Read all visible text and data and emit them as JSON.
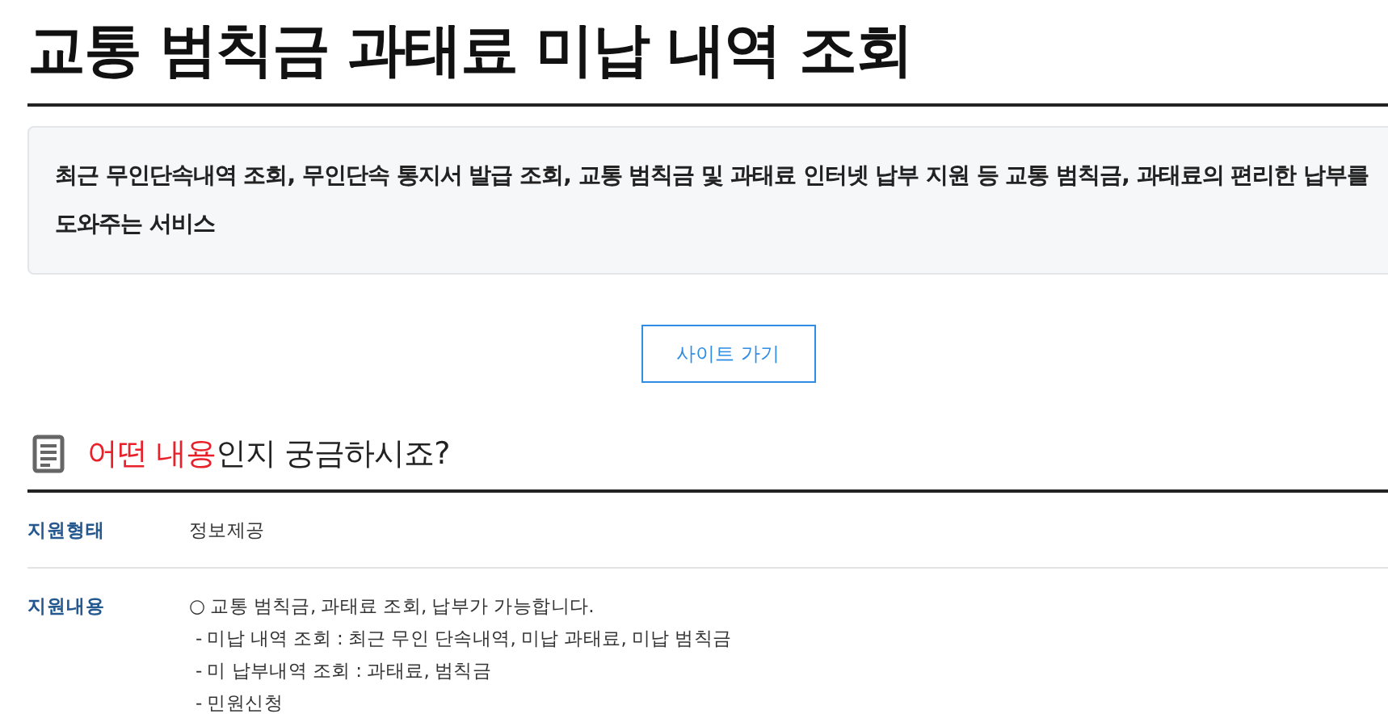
{
  "title": "교통 범칙금 과태료 미납 내역 조회",
  "description": "최근 무인단속내역 조회, 무인단속 통지서 발급 조회, 교통 범칙금 및 과태료 인터넷 납부 지원 등 교통 범칙금, 과태료의 편리한 납부를 도와주는 서비스",
  "site_button": "사이트 가기",
  "section_heading": {
    "highlight": "어떤 내용",
    "rest": "인지 궁금하시죠?"
  },
  "rows": [
    {
      "label": "지원형태",
      "lines": [
        "정보제공"
      ]
    },
    {
      "label": "지원내용",
      "lines": [
        "○ 교통 범칙금, 과태료 조회, 납부가 가능합니다.",
        "- 미납 내역 조회 : 최근 무인 단속내역, 미납 과태료, 미납 범칙금",
        "- 미 납부내역 조회 : 과태료, 범칙금",
        "- 민원신청"
      ]
    }
  ]
}
